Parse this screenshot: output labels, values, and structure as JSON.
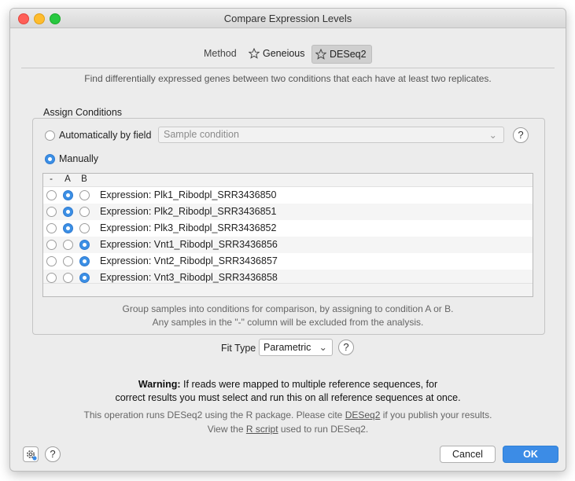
{
  "window": {
    "title": "Compare Expression Levels"
  },
  "method": {
    "label": "Method",
    "options": [
      {
        "label": "Geneious",
        "icon": "star-icon",
        "selected": false
      },
      {
        "label": "DESeq2",
        "icon": "star-icon",
        "selected": true
      }
    ],
    "description": "Find differentially expressed genes between two conditions that each have at least two replicates."
  },
  "assign": {
    "legend": "Assign Conditions",
    "auto_label": "Automatically by field",
    "auto_selected": false,
    "field_placeholder": "Sample condition",
    "manual_label": "Manually",
    "manual_selected": true,
    "columns": [
      "-",
      "A",
      "B"
    ],
    "rows": [
      {
        "label": "Expression: Plk1_Ribodpl_SRR3436850",
        "condition": "A"
      },
      {
        "label": "Expression: Plk2_Ribodpl_SRR3436851",
        "condition": "A"
      },
      {
        "label": "Expression: Plk3_Ribodpl_SRR3436852",
        "condition": "A"
      },
      {
        "label": "Expression: Vnt1_Ribodpl_SRR3436856",
        "condition": "B"
      },
      {
        "label": "Expression: Vnt2_Ribodpl_SRR3436857",
        "condition": "B"
      },
      {
        "label": "Expression: Vnt3_Ribodpl_SRR3436858",
        "condition": "B"
      }
    ],
    "note_line1": "Group samples into conditions for comparison, by assigning to condition A or B.",
    "note_line2": "Any samples in the \"-\" column will be excluded from the analysis."
  },
  "fit": {
    "label": "Fit Type",
    "value": "Parametric"
  },
  "warning": {
    "bold": "Warning:",
    "line1_rest": " If reads were mapped to multiple reference sequences, for",
    "line2": "correct results you must select and run this on all reference sequences at once."
  },
  "info": {
    "line1_pre": "This operation runs DESeq2 using the R package. Please cite ",
    "line1_link": "DESeq2",
    "line1_post": " if you publish your results.",
    "line2_pre": "View the ",
    "line2_link": "R script",
    "line2_post": " used to run DESeq2."
  },
  "buttons": {
    "cancel": "Cancel",
    "ok": "OK",
    "help": "?"
  },
  "colors": {
    "accent": "#3c8ce6",
    "close": "#ff5f57",
    "minimize": "#febc2e",
    "maximize": "#28c840"
  }
}
